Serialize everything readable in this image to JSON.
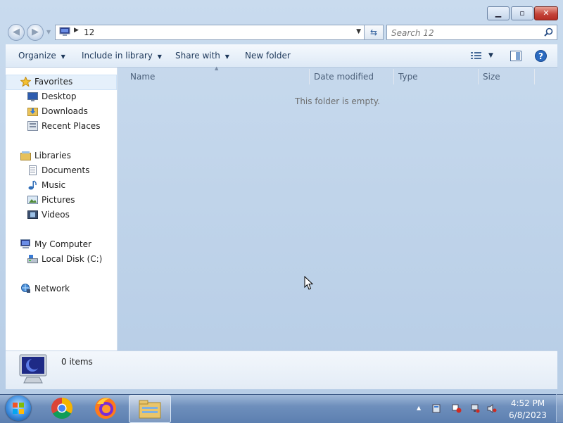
{
  "window": {
    "controls": {
      "minimize_icon": "minimize-icon",
      "maximize_icon": "maximize-icon",
      "close_icon": "close-icon"
    }
  },
  "address_bar": {
    "path_segment": "12",
    "dropdown_icon": "chevron-down-icon",
    "refresh_icon": "refresh-icon"
  },
  "search": {
    "placeholder": "Search 12",
    "icon": "search-icon"
  },
  "toolbar": {
    "organize": "Organize",
    "include_in_library": "Include in library",
    "share_with": "Share with",
    "new_folder": "New folder"
  },
  "navigation": {
    "favorites": "Favorites",
    "favorites_items": [
      "Desktop",
      "Downloads",
      "Recent Places"
    ],
    "libraries": "Libraries",
    "libraries_items": [
      "Documents",
      "Music",
      "Pictures",
      "Videos"
    ],
    "computer": "My Computer",
    "computer_items": [
      "Local Disk (C:)"
    ],
    "network": "Network"
  },
  "columns": {
    "name": "Name",
    "date_modified": "Date modified",
    "type": "Type",
    "size": "Size"
  },
  "content": {
    "empty_message": "This folder is empty."
  },
  "details": {
    "item_count": "0 items"
  },
  "taskbar": {
    "apps": [
      "start-orb",
      "chrome-icon",
      "firefox-icon",
      "explorer-icon"
    ],
    "time": "4:52 PM",
    "date": "6/8/2023"
  },
  "colors": {
    "selection": "#e5f0fb",
    "accent": "#1e395b",
    "close": "#c4443a"
  }
}
